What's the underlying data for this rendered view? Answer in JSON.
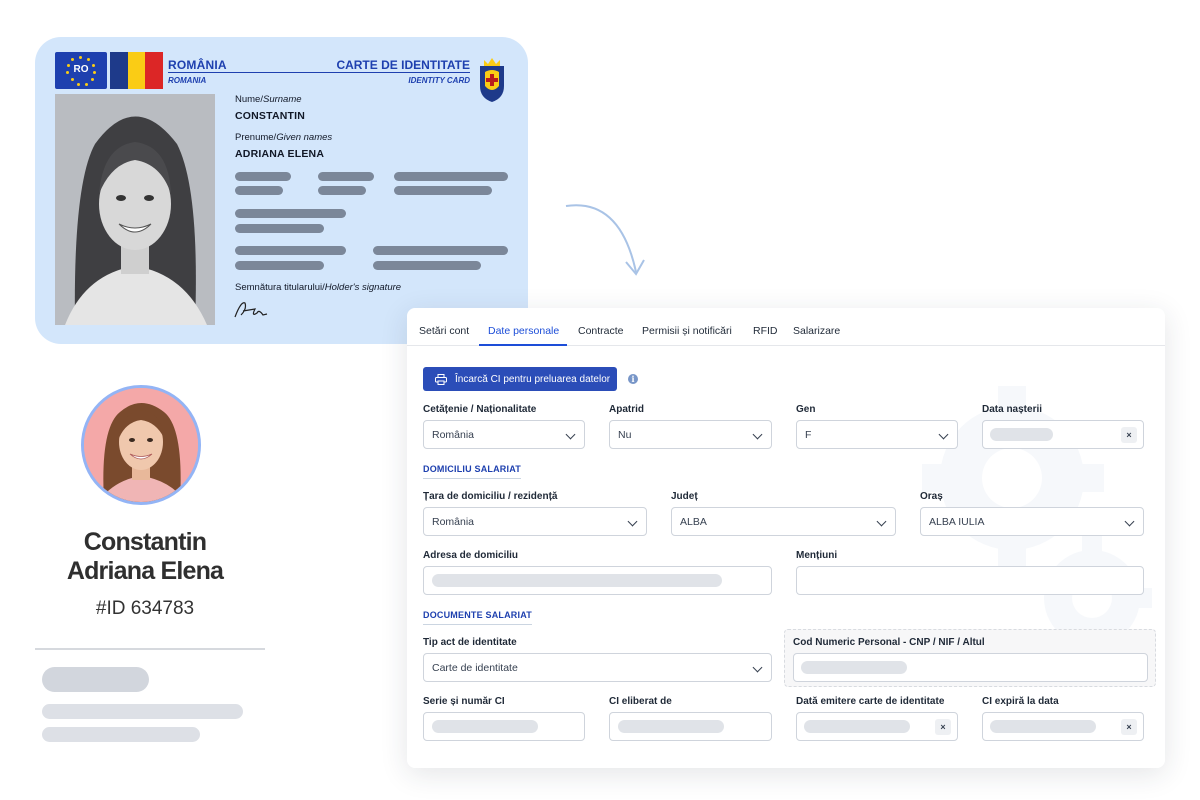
{
  "id_card": {
    "eu_code": "RO",
    "country": "ROMÂNIA",
    "country_sub": "ROMANIA",
    "type": "CARTE DE IDENTITATE",
    "type_sub": "IDENTITY CARD",
    "surname_label_ro": "Nume/",
    "surname_label_en": "Surname",
    "surname": "CONSTANTIN",
    "given_label_ro": "Prenume/",
    "given_label_en": "Given names",
    "given": "ADRIANA ELENA",
    "signature_label_ro": "Semnătura titularului/",
    "signature_label_en": "Holder's signature"
  },
  "profile": {
    "name_line1": "Constantin",
    "name_line2": "Adriana Elena",
    "id": "#ID 634783"
  },
  "tabs": [
    "Setări cont",
    "Date personale",
    "Contracte",
    "Permisii și notificări",
    "RFID",
    "Salarizare"
  ],
  "active_tab": "Date personale",
  "form": {
    "upload_button": "Încarcă CI pentru preluarea datelor",
    "citizenship_label": "Cetățenie / Naționalitate",
    "citizenship_value": "România",
    "stateless_label": "Apatrid",
    "stateless_value": "Nu",
    "gender_label": "Gen",
    "gender_value": "F",
    "birthdate_label": "Data nașterii",
    "section_domicile": "DOMICILIU SALARIAT",
    "country_label": "Țara de domiciliu / rezidență",
    "country_value": "România",
    "county_label": "Județ",
    "county_value": "ALBA",
    "city_label": "Oraș",
    "city_value": "ALBA IULIA",
    "address_label": "Adresa de domiciliu",
    "notes_label": "Mențiuni",
    "section_documents": "DOCUMENTE SALARIAT",
    "id_type_label": "Tip act de identitate",
    "id_type_value": "Carte de identitate",
    "cnp_label": "Cod Numeric Personal - CNP / NIF / Altul",
    "series_label": "Serie și număr CI",
    "issued_by_label": "CI eliberat de",
    "issue_date_label": "Dată emitere carte de identitate",
    "expiry_label": "CI expiră la data",
    "clear_glyph": "×"
  }
}
